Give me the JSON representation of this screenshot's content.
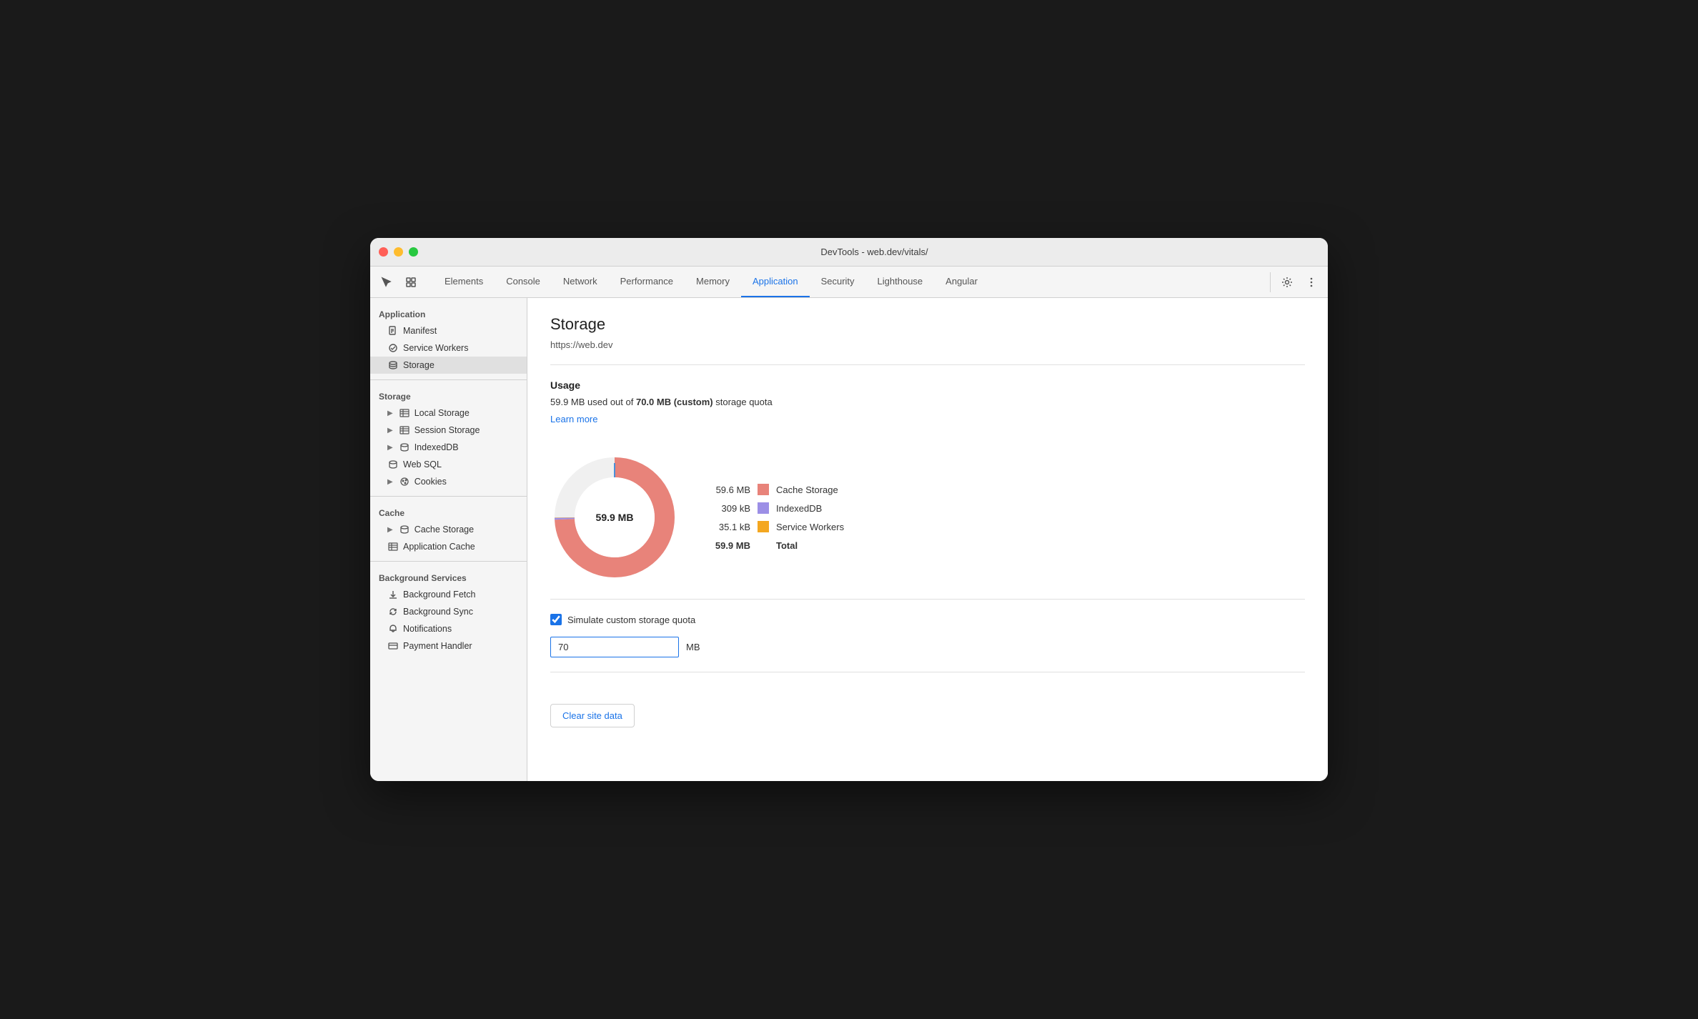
{
  "window": {
    "title": "DevTools - web.dev/vitals/"
  },
  "toolbar": {
    "tabs": [
      {
        "id": "elements",
        "label": "Elements",
        "active": false
      },
      {
        "id": "console",
        "label": "Console",
        "active": false
      },
      {
        "id": "network",
        "label": "Network",
        "active": false
      },
      {
        "id": "performance",
        "label": "Performance",
        "active": false
      },
      {
        "id": "memory",
        "label": "Memory",
        "active": false
      },
      {
        "id": "application",
        "label": "Application",
        "active": true
      },
      {
        "id": "security",
        "label": "Security",
        "active": false
      },
      {
        "id": "lighthouse",
        "label": "Lighthouse",
        "active": false
      },
      {
        "id": "angular",
        "label": "Angular",
        "active": false
      }
    ]
  },
  "sidebar": {
    "sections": [
      {
        "label": "Application",
        "items": [
          {
            "id": "manifest",
            "icon": "doc",
            "label": "Manifest",
            "hasArrow": false,
            "active": false
          },
          {
            "id": "service-workers",
            "icon": "gear",
            "label": "Service Workers",
            "hasArrow": false,
            "active": false
          },
          {
            "id": "storage-item",
            "icon": "db",
            "label": "Storage",
            "hasArrow": false,
            "active": true
          }
        ]
      },
      {
        "label": "Storage",
        "items": [
          {
            "id": "local-storage",
            "icon": "grid",
            "label": "Local Storage",
            "hasArrow": true,
            "active": false
          },
          {
            "id": "session-storage",
            "icon": "grid",
            "label": "Session Storage",
            "hasArrow": true,
            "active": false
          },
          {
            "id": "indexeddb",
            "icon": "db",
            "label": "IndexedDB",
            "hasArrow": true,
            "active": false
          },
          {
            "id": "web-sql",
            "icon": "db",
            "label": "Web SQL",
            "hasArrow": false,
            "active": false
          },
          {
            "id": "cookies",
            "icon": "cookie",
            "label": "Cookies",
            "hasArrow": true,
            "active": false
          }
        ]
      },
      {
        "label": "Cache",
        "items": [
          {
            "id": "cache-storage",
            "icon": "db",
            "label": "Cache Storage",
            "hasArrow": true,
            "active": false
          },
          {
            "id": "application-cache",
            "icon": "grid",
            "label": "Application Cache",
            "hasArrow": false,
            "active": false
          }
        ]
      },
      {
        "label": "Background Services",
        "items": [
          {
            "id": "background-fetch",
            "icon": "fetch",
            "label": "Background Fetch",
            "hasArrow": false,
            "active": false
          },
          {
            "id": "background-sync",
            "icon": "sync",
            "label": "Background Sync",
            "hasArrow": false,
            "active": false
          },
          {
            "id": "notifications",
            "icon": "bell",
            "label": "Notifications",
            "hasArrow": false,
            "active": false
          },
          {
            "id": "payment-handler",
            "icon": "card",
            "label": "Payment Handler",
            "hasArrow": false,
            "active": false
          }
        ]
      }
    ]
  },
  "content": {
    "title": "Storage",
    "url": "https://web.dev",
    "usage": {
      "section_title": "Usage",
      "description_prefix": "59.9 MB used out of ",
      "bold_part": "70.0 MB (custom)",
      "description_suffix": " storage quota",
      "learn_more": "Learn more"
    },
    "chart": {
      "center_label": "59.9 MB",
      "total_value": "59.9 MB",
      "total_label": "Total",
      "legend": [
        {
          "value": "59.6 MB",
          "color": "#e8837a",
          "name": "Cache Storage",
          "bold": false
        },
        {
          "value": "309 kB",
          "color": "#9c8fe6",
          "name": "IndexedDB",
          "bold": false
        },
        {
          "value": "35.1 kB",
          "color": "#f4a720",
          "name": "Service Workers",
          "bold": false
        },
        {
          "value": "59.9 MB",
          "color": null,
          "name": "Total",
          "bold": true
        }
      ]
    },
    "simulate_checkbox": {
      "checked": true,
      "label": "Simulate custom storage quota"
    },
    "quota_input": {
      "value": "70",
      "unit": "MB"
    },
    "clear_button": "Clear site data"
  }
}
